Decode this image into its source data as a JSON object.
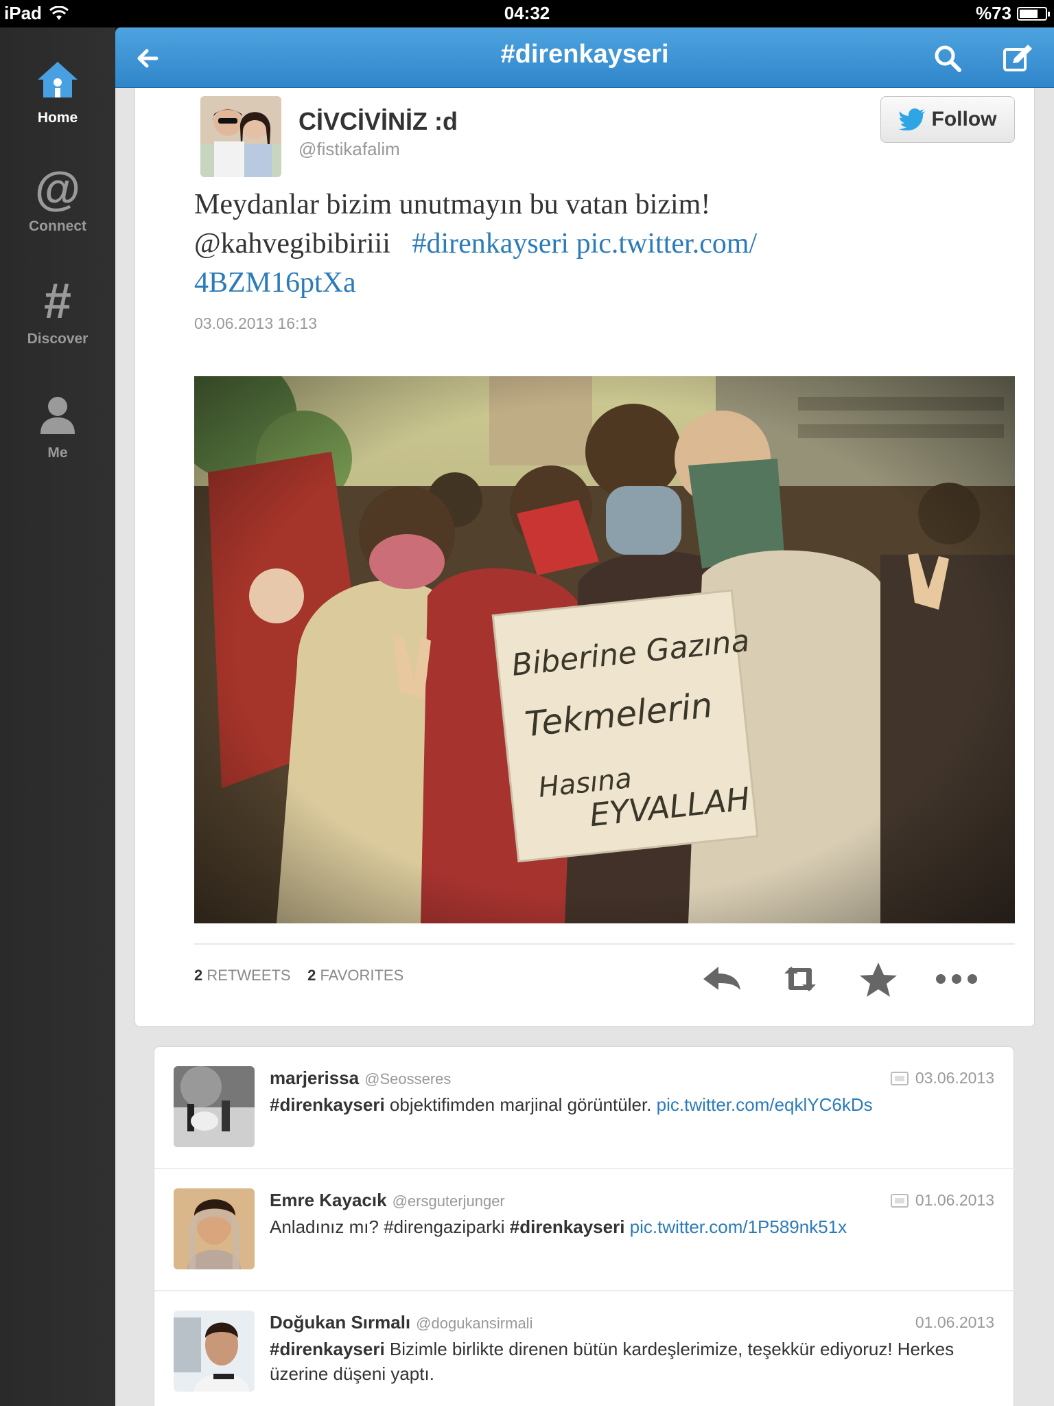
{
  "status_bar": {
    "device": "iPad",
    "time": "04:32",
    "battery": "%73",
    "battery_level": 0.73
  },
  "sidebar": {
    "items": [
      {
        "label": "Home",
        "icon": "home-icon",
        "active": true
      },
      {
        "label": "Connect",
        "icon": "at-icon",
        "active": false
      },
      {
        "label": "Discover",
        "icon": "hash-icon",
        "active": false
      },
      {
        "label": "Me",
        "icon": "person-icon",
        "active": false
      }
    ]
  },
  "header": {
    "title": "#direnkayseri",
    "back_icon": "back-arrow-icon",
    "search_icon": "search-icon",
    "compose_icon": "compose-icon"
  },
  "tweet": {
    "display_name": "CİVCİVİNİZ :d",
    "handle": "@fistikafalim",
    "follow_label": "Follow",
    "text_line1": "Meydanlar bizim unutmayın bu vatan bizim!",
    "mention": "@kahvegibibiriii",
    "hashtag": "#direnkayseri",
    "link_part1": "pic.twitter.com/",
    "link_part2": "4BZM16ptXa",
    "timestamp": "03.06.2013 16:13",
    "retweets_count": "2",
    "retweets_label": "RETWEETS",
    "favorites_count": "2",
    "favorites_label": "FAVORITES",
    "photo_sign": {
      "line1": "Biberine Gazına",
      "line2": "Tekmelerin",
      "line3": "Hasına",
      "line4": "EYVALLAH"
    }
  },
  "timeline": [
    {
      "name": "marjerissa",
      "handle": "@Seosseres",
      "date": "03.06.2013",
      "has_media": true,
      "bold": "#direnkayseri",
      "text": " objektifimden marjinal görüntüler. ",
      "link": "pic.twitter.com/eqklYC6kDs",
      "text2": ""
    },
    {
      "name": "Emre Kayacık",
      "handle": "@ersguterjunger",
      "date": "01.06.2013",
      "has_media": true,
      "pre": "Anladınız mı? #direngaziparki ",
      "bold": "#direnkayseri",
      "text": " ",
      "link": "pic.twitter.com/1P589nk51x",
      "text2": ""
    },
    {
      "name": "Doğukan Sırmalı",
      "handle": "@dogukansirmali",
      "date": "01.06.2013",
      "has_media": false,
      "bold": "#direnkayseri",
      "text": " Bizimle birlikte direnen bütün kardeşlerimize, teşekkür ediyoruz! Herkes üzerine düşeni yaptı.",
      "link": "",
      "text2": ""
    }
  ],
  "colors": {
    "accent": "#2f86c9",
    "link": "#2b7bb9"
  }
}
